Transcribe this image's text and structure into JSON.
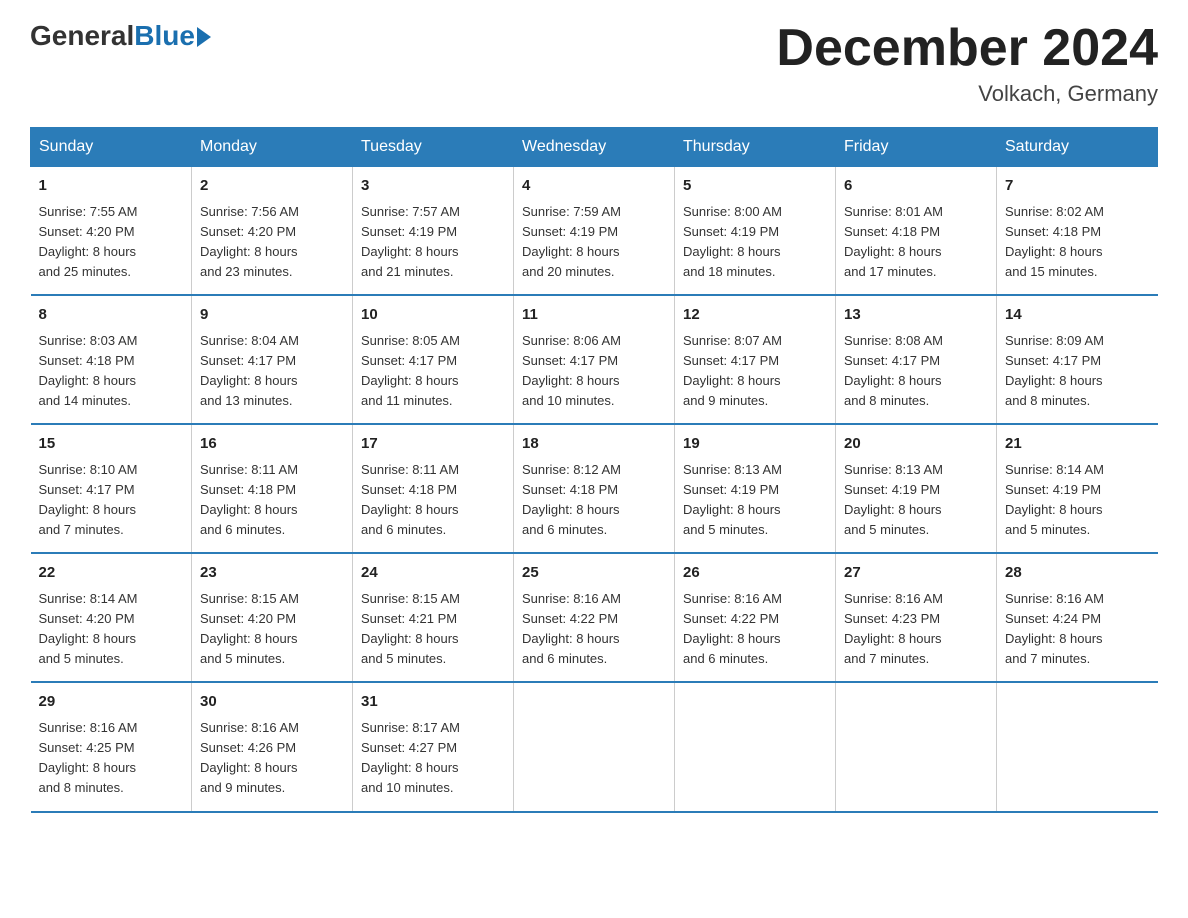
{
  "logo": {
    "general": "General",
    "blue": "Blue"
  },
  "title": "December 2024",
  "location": "Volkach, Germany",
  "days_of_week": [
    "Sunday",
    "Monday",
    "Tuesday",
    "Wednesday",
    "Thursday",
    "Friday",
    "Saturday"
  ],
  "weeks": [
    [
      {
        "day": "1",
        "info": "Sunrise: 7:55 AM\nSunset: 4:20 PM\nDaylight: 8 hours\nand 25 minutes."
      },
      {
        "day": "2",
        "info": "Sunrise: 7:56 AM\nSunset: 4:20 PM\nDaylight: 8 hours\nand 23 minutes."
      },
      {
        "day": "3",
        "info": "Sunrise: 7:57 AM\nSunset: 4:19 PM\nDaylight: 8 hours\nand 21 minutes."
      },
      {
        "day": "4",
        "info": "Sunrise: 7:59 AM\nSunset: 4:19 PM\nDaylight: 8 hours\nand 20 minutes."
      },
      {
        "day": "5",
        "info": "Sunrise: 8:00 AM\nSunset: 4:19 PM\nDaylight: 8 hours\nand 18 minutes."
      },
      {
        "day": "6",
        "info": "Sunrise: 8:01 AM\nSunset: 4:18 PM\nDaylight: 8 hours\nand 17 minutes."
      },
      {
        "day": "7",
        "info": "Sunrise: 8:02 AM\nSunset: 4:18 PM\nDaylight: 8 hours\nand 15 minutes."
      }
    ],
    [
      {
        "day": "8",
        "info": "Sunrise: 8:03 AM\nSunset: 4:18 PM\nDaylight: 8 hours\nand 14 minutes."
      },
      {
        "day": "9",
        "info": "Sunrise: 8:04 AM\nSunset: 4:17 PM\nDaylight: 8 hours\nand 13 minutes."
      },
      {
        "day": "10",
        "info": "Sunrise: 8:05 AM\nSunset: 4:17 PM\nDaylight: 8 hours\nand 11 minutes."
      },
      {
        "day": "11",
        "info": "Sunrise: 8:06 AM\nSunset: 4:17 PM\nDaylight: 8 hours\nand 10 minutes."
      },
      {
        "day": "12",
        "info": "Sunrise: 8:07 AM\nSunset: 4:17 PM\nDaylight: 8 hours\nand 9 minutes."
      },
      {
        "day": "13",
        "info": "Sunrise: 8:08 AM\nSunset: 4:17 PM\nDaylight: 8 hours\nand 8 minutes."
      },
      {
        "day": "14",
        "info": "Sunrise: 8:09 AM\nSunset: 4:17 PM\nDaylight: 8 hours\nand 8 minutes."
      }
    ],
    [
      {
        "day": "15",
        "info": "Sunrise: 8:10 AM\nSunset: 4:17 PM\nDaylight: 8 hours\nand 7 minutes."
      },
      {
        "day": "16",
        "info": "Sunrise: 8:11 AM\nSunset: 4:18 PM\nDaylight: 8 hours\nand 6 minutes."
      },
      {
        "day": "17",
        "info": "Sunrise: 8:11 AM\nSunset: 4:18 PM\nDaylight: 8 hours\nand 6 minutes."
      },
      {
        "day": "18",
        "info": "Sunrise: 8:12 AM\nSunset: 4:18 PM\nDaylight: 8 hours\nand 6 minutes."
      },
      {
        "day": "19",
        "info": "Sunrise: 8:13 AM\nSunset: 4:19 PM\nDaylight: 8 hours\nand 5 minutes."
      },
      {
        "day": "20",
        "info": "Sunrise: 8:13 AM\nSunset: 4:19 PM\nDaylight: 8 hours\nand 5 minutes."
      },
      {
        "day": "21",
        "info": "Sunrise: 8:14 AM\nSunset: 4:19 PM\nDaylight: 8 hours\nand 5 minutes."
      }
    ],
    [
      {
        "day": "22",
        "info": "Sunrise: 8:14 AM\nSunset: 4:20 PM\nDaylight: 8 hours\nand 5 minutes."
      },
      {
        "day": "23",
        "info": "Sunrise: 8:15 AM\nSunset: 4:20 PM\nDaylight: 8 hours\nand 5 minutes."
      },
      {
        "day": "24",
        "info": "Sunrise: 8:15 AM\nSunset: 4:21 PM\nDaylight: 8 hours\nand 5 minutes."
      },
      {
        "day": "25",
        "info": "Sunrise: 8:16 AM\nSunset: 4:22 PM\nDaylight: 8 hours\nand 6 minutes."
      },
      {
        "day": "26",
        "info": "Sunrise: 8:16 AM\nSunset: 4:22 PM\nDaylight: 8 hours\nand 6 minutes."
      },
      {
        "day": "27",
        "info": "Sunrise: 8:16 AM\nSunset: 4:23 PM\nDaylight: 8 hours\nand 7 minutes."
      },
      {
        "day": "28",
        "info": "Sunrise: 8:16 AM\nSunset: 4:24 PM\nDaylight: 8 hours\nand 7 minutes."
      }
    ],
    [
      {
        "day": "29",
        "info": "Sunrise: 8:16 AM\nSunset: 4:25 PM\nDaylight: 8 hours\nand 8 minutes."
      },
      {
        "day": "30",
        "info": "Sunrise: 8:16 AM\nSunset: 4:26 PM\nDaylight: 8 hours\nand 9 minutes."
      },
      {
        "day": "31",
        "info": "Sunrise: 8:17 AM\nSunset: 4:27 PM\nDaylight: 8 hours\nand 10 minutes."
      },
      null,
      null,
      null,
      null
    ]
  ]
}
